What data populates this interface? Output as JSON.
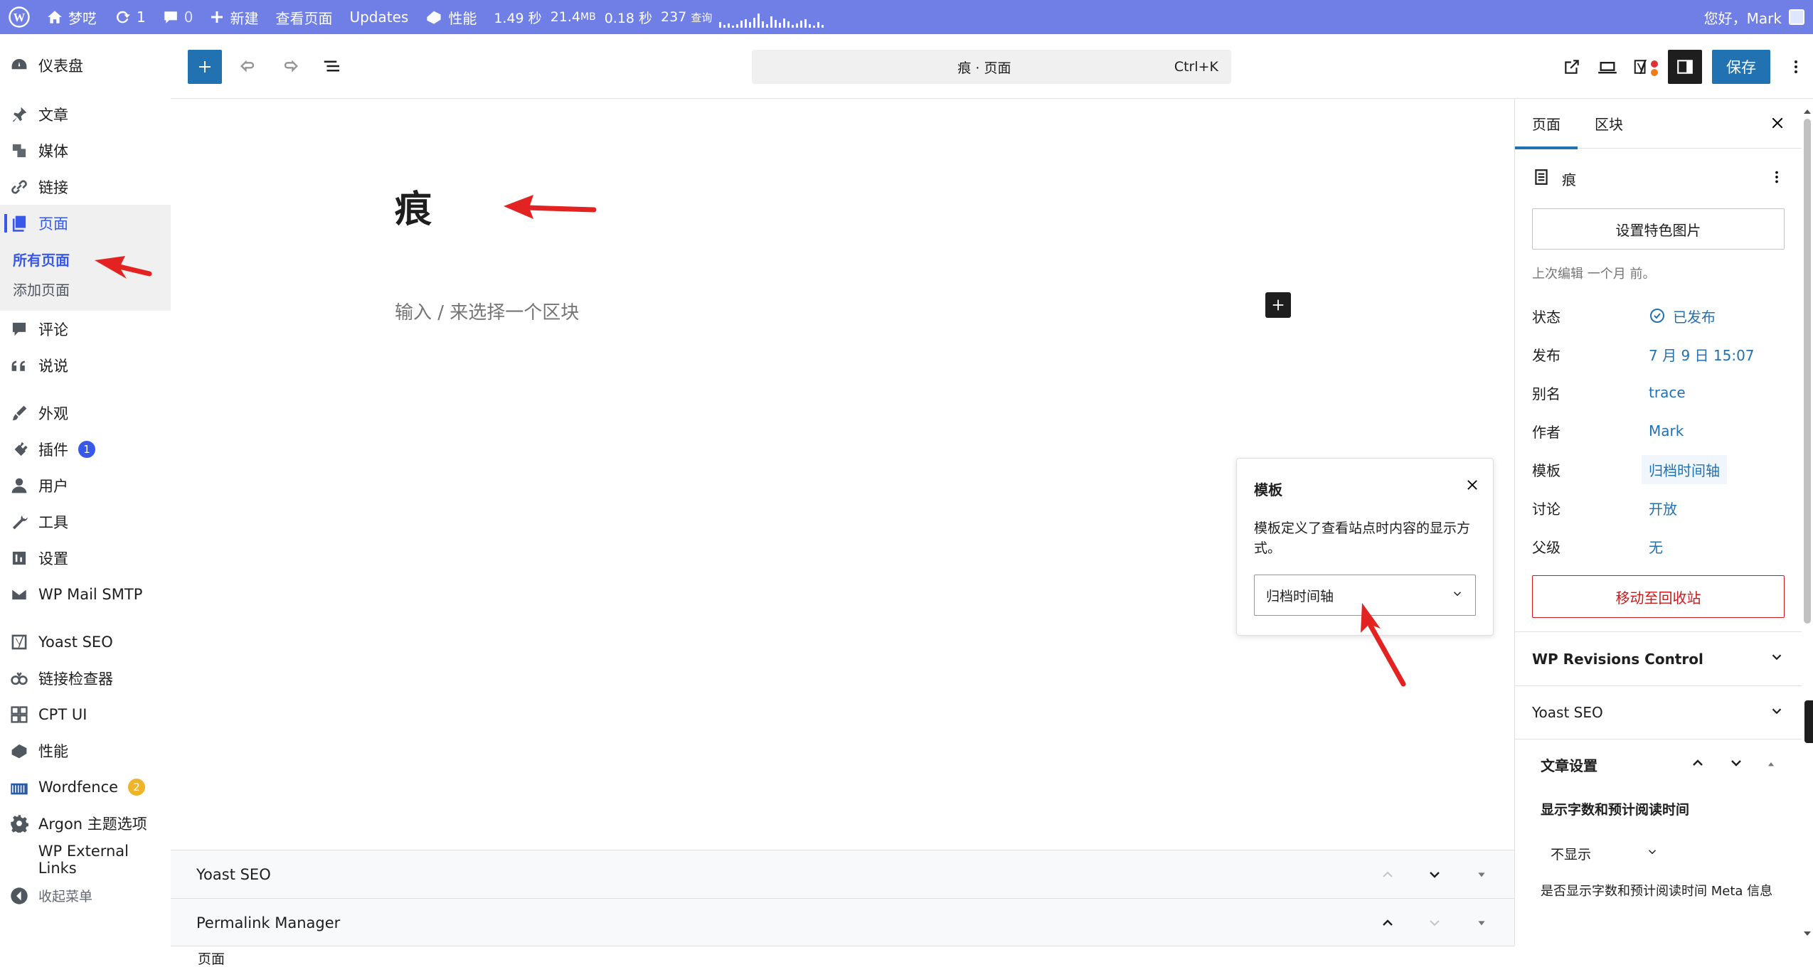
{
  "admin_bar": {
    "site_name": "梦呓",
    "updates_count": "1",
    "comments_count": "0",
    "new_label": "新建",
    "view_page_label": "查看页面",
    "updates_label": "Updates",
    "perf_label": "性能",
    "perf_time": "1.49 秒",
    "perf_memory": "21.4",
    "perf_memory_unit": "MB",
    "perf_query_time": "0.18 秒",
    "perf_queries": "237",
    "perf_queries_unit": "查询",
    "greeting": "您好，Mark"
  },
  "sidebar": {
    "items": [
      {
        "label": "仪表盘",
        "icon": "dashboard-icon"
      },
      {
        "label": "文章",
        "icon": "pin-icon"
      },
      {
        "label": "媒体",
        "icon": "media-icon"
      },
      {
        "label": "链接",
        "icon": "link-icon"
      },
      {
        "label": "页面",
        "icon": "pages-icon"
      },
      {
        "label": "评论",
        "icon": "comment-icon"
      },
      {
        "label": "说说",
        "icon": "quote-icon"
      },
      {
        "label": "外观",
        "icon": "brush-icon"
      },
      {
        "label": "插件",
        "icon": "plugin-icon",
        "badge": "1"
      },
      {
        "label": "用户",
        "icon": "users-icon"
      },
      {
        "label": "工具",
        "icon": "wrench-icon"
      },
      {
        "label": "设置",
        "icon": "settings-icon"
      },
      {
        "label": "WP Mail SMTP",
        "icon": "mail-icon"
      },
      {
        "label": "Yoast SEO",
        "icon": "yoast-icon"
      },
      {
        "label": "链接检查器",
        "icon": "link-checker-icon"
      },
      {
        "label": "CPT UI",
        "icon": "grid-icon"
      },
      {
        "label": "性能",
        "icon": "performance-icon"
      },
      {
        "label": "Wordfence",
        "icon": "wordfence-icon",
        "badge": "2"
      },
      {
        "label": "Argon 主题选项",
        "icon": "gear-icon"
      },
      {
        "label": "WP External Links",
        "icon": ""
      },
      {
        "label": "收起菜单",
        "icon": "collapse-icon"
      }
    ],
    "submenu": [
      "所有页面",
      "添加页面"
    ]
  },
  "editor": {
    "command_title": "痕 · 页面",
    "command_shortcut": "Ctrl+K",
    "save_label": "保存",
    "post_title": "痕",
    "block_placeholder": "输入 / 来选择一个区块"
  },
  "template_popover": {
    "title": "模板",
    "description": "模板定义了查看站点时内容的显示方式。",
    "selected": "归档时间轴"
  },
  "metaboxes": [
    "Yoast SEO",
    "Permalink Manager"
  ],
  "breadcrumb": "页面",
  "inspector": {
    "tabs": [
      "页面",
      "区块"
    ],
    "page_title": "痕",
    "featured_image_label": "设置特色图片",
    "last_edited": "上次编辑 一个月 前。",
    "rows": [
      {
        "key": "状态",
        "value": "已发布"
      },
      {
        "key": "发布",
        "value": "7 月 9 日 15:07"
      },
      {
        "key": "别名",
        "value": "trace"
      },
      {
        "key": "作者",
        "value": "Mark"
      },
      {
        "key": "模板",
        "value": "归档时间轴"
      },
      {
        "key": "讨论",
        "value": "开放"
      },
      {
        "key": "父级",
        "value": "无"
      }
    ],
    "trash_label": "移动至回收站",
    "panels": [
      "WP Revisions Control",
      "Yoast SEO"
    ],
    "article_settings_title": "文章设置",
    "wordcount_label": "显示字数和预计阅读时间",
    "wordcount_value": "不显示",
    "wordcount_desc": "是否显示字数和预计阅读时间 Meta 信息"
  },
  "colors": {
    "admin_bar": "#6f7fe6",
    "accent": "#2271b1",
    "menu_active": "#3858e9",
    "danger": "#cc1818",
    "annotation_arrow": "#e32222",
    "badge_plugins": "#3858e9",
    "badge_wordfence": "#f0b429"
  }
}
